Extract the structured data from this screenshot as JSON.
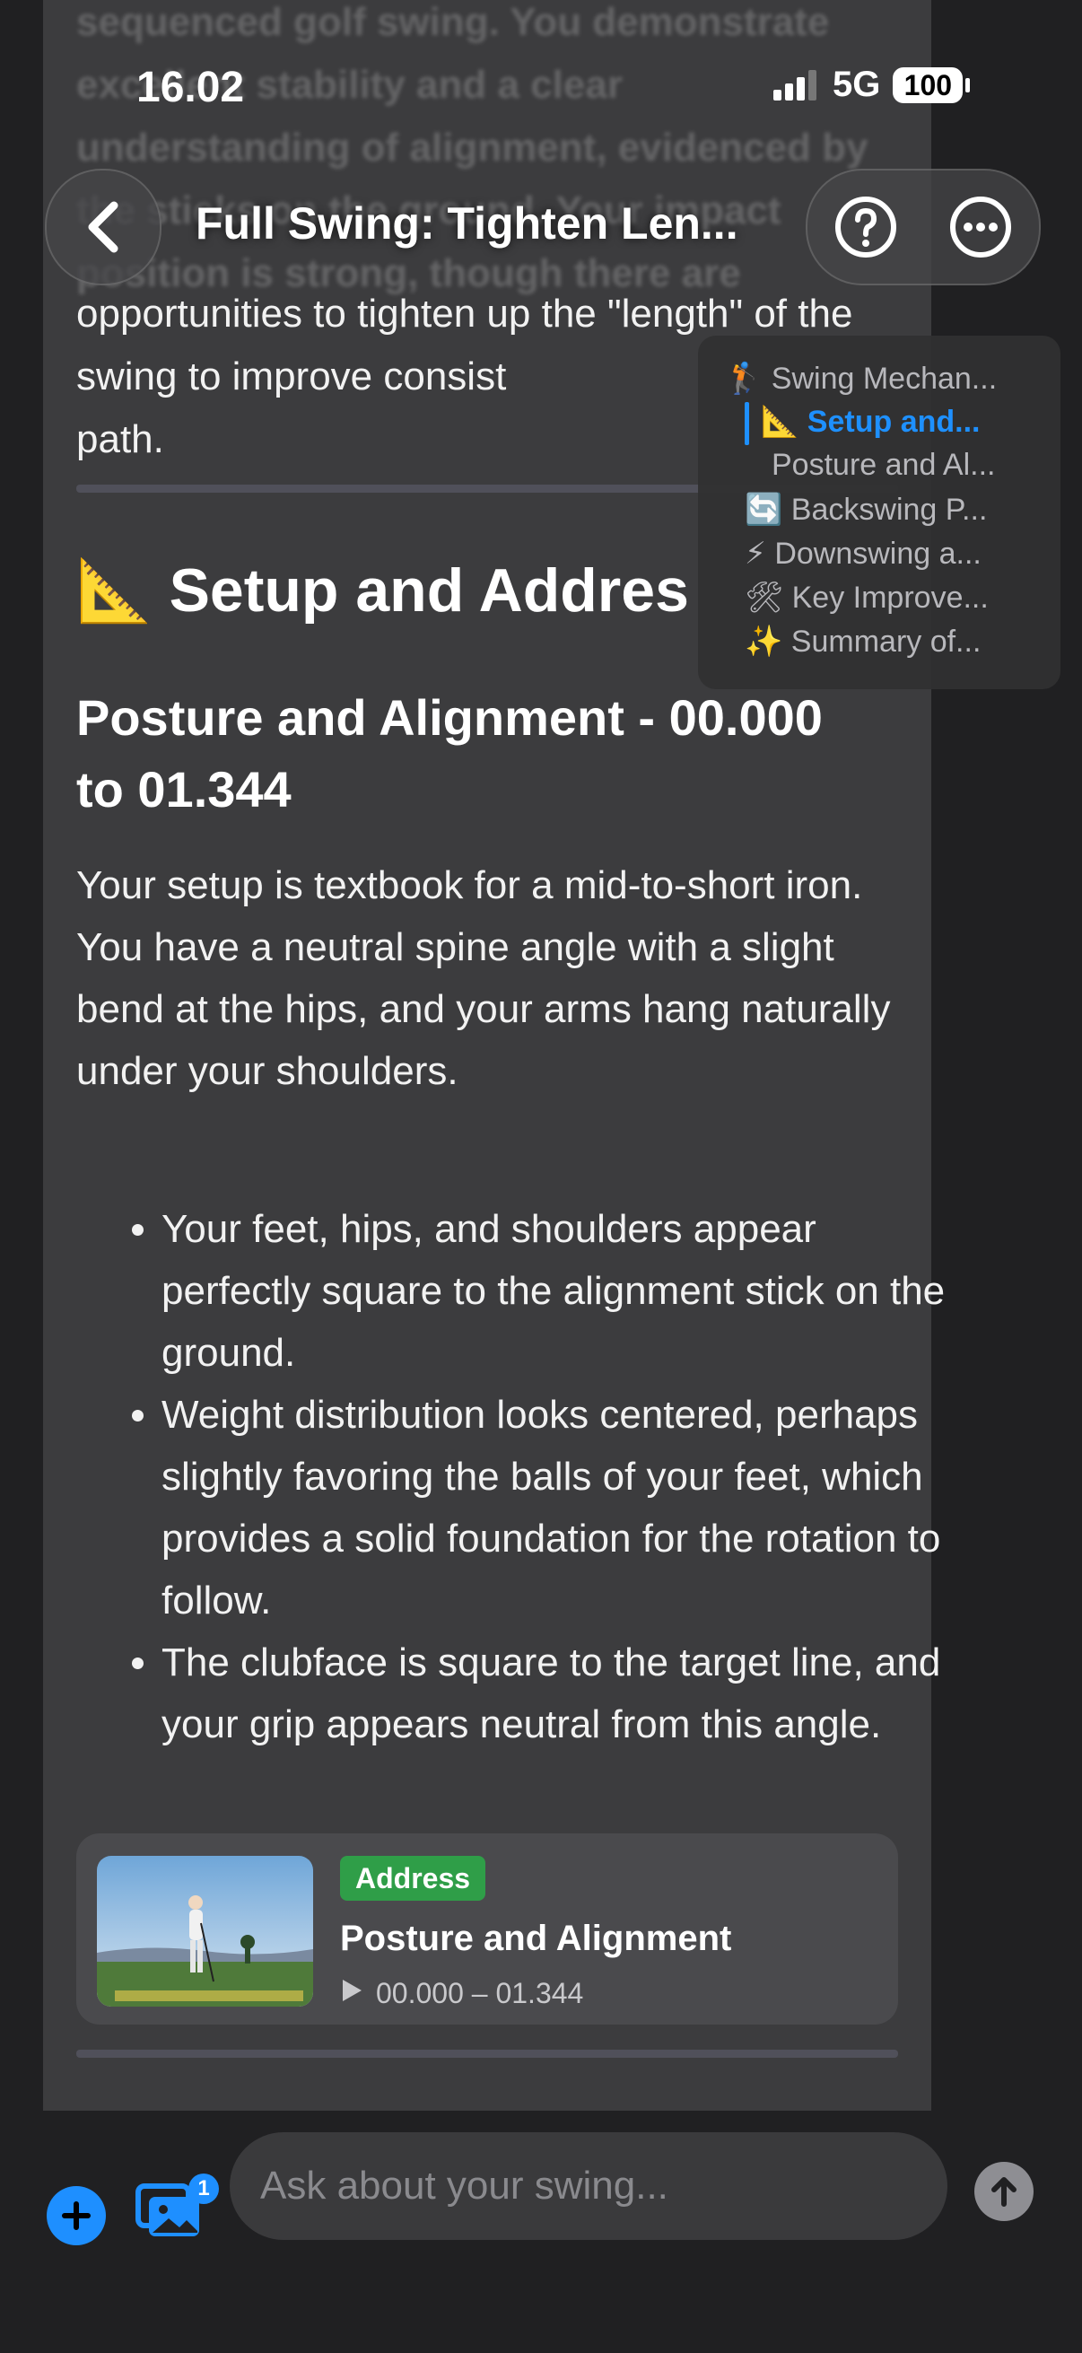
{
  "status": {
    "time": "16.02",
    "network": "5G",
    "battery": "100"
  },
  "header": {
    "title": "Full Swing: Tighten Len...",
    "back_icon": "chevron-left-icon",
    "help_icon": "question-circle-icon",
    "more_icon": "ellipsis-circle-icon"
  },
  "intro_faded": "sequenced golf swing. You demonstrate excellent stability and a clear understanding of alignment, evidenced by the sticks on the ground. Your impact position is strong, though there are",
  "intro_visible": "opportunities to tighten up the \"length\" of the swing to improve consist",
  "intro_visible_2": "path.",
  "section": {
    "emoji": "📐",
    "title": "Setup and Addres"
  },
  "subsection": {
    "title": "Posture and Alignment - 00.000 to 01.344"
  },
  "paragraph": "Your setup is textbook for a mid-to-short iron. You have a neutral spine angle with a slight bend at the hips, and your arms hang naturally under your shoulders.",
  "bullets": [
    "Your feet, hips, and shoulders appear perfectly square to the alignment stick on the ground.",
    "Weight distribution looks centered, perhaps slightly favoring the balls of your feet, which provides a solid foundation for the rotation to follow.",
    "The clubface is square to the target line, and your grip appears neutral from this angle."
  ],
  "clip": {
    "badge": "Address",
    "title": "Posture and Alignment",
    "time": "00.000 – 01.344",
    "badge_color": "#2f9e48"
  },
  "toc": [
    {
      "emoji": "🏌",
      "label": "Swing Mechan..."
    },
    {
      "emoji": "📐",
      "label": "Setup and...",
      "active": true
    },
    {
      "emoji": "",
      "label": "Posture and Al..."
    },
    {
      "emoji": "🔄",
      "label": "Backswing P..."
    },
    {
      "emoji": "⚡",
      "label": "Downswing a..."
    },
    {
      "emoji": "🛠",
      "label": "Key Improve..."
    },
    {
      "emoji": "✨",
      "label": "Summary of..."
    }
  ],
  "composer": {
    "placeholder": "Ask about your swing...",
    "media_count": "1"
  },
  "colors": {
    "accent": "#1e8fff",
    "background": "#202022",
    "card": "#3c3c3e"
  }
}
